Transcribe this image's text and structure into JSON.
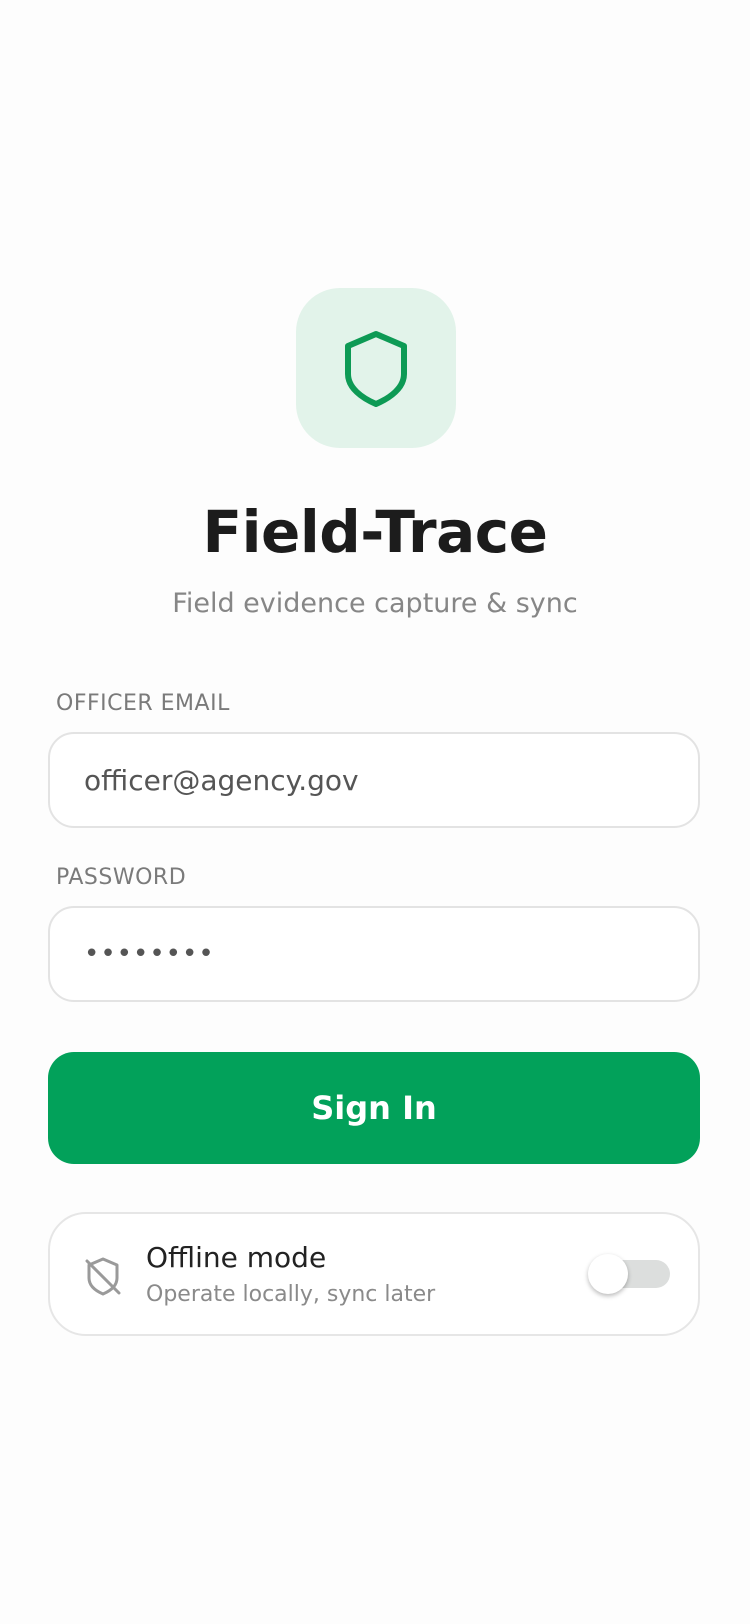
{
  "app": {
    "title": "Field-Trace",
    "subtitle": "Field evidence capture & sync",
    "logo_icon": "shield-icon"
  },
  "form": {
    "email_label": "OFFICER EMAIL",
    "email_value": "officer@agency.gov",
    "password_label": "PASSWORD",
    "password_value": "••••••••",
    "sign_in_label": "Sign In"
  },
  "offline": {
    "title": "Offline mode",
    "subtitle": "Operate locally, sync later",
    "icon": "shield-off-icon",
    "enabled": false
  },
  "colors": {
    "accent": "#02a15a",
    "logo_background": "#e2f3ea",
    "toggle_track": "#dcdedd"
  }
}
